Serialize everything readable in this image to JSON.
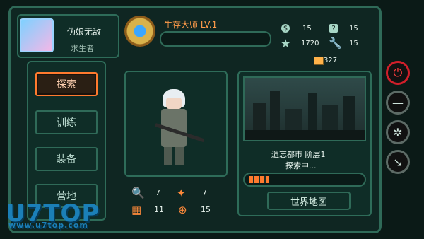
{
  "profile": {
    "name": "伪娘无敌",
    "role": "求生者"
  },
  "rank": {
    "title": "生存大师 LV.1"
  },
  "stats": {
    "coins": "15",
    "help": "15",
    "stars": "1720",
    "tools": "15",
    "capacity": "327"
  },
  "sidebar": {
    "items": [
      {
        "label": "探索",
        "active": true
      },
      {
        "label": "训练",
        "active": false
      },
      {
        "label": "装备",
        "active": false
      },
      {
        "label": "营地",
        "active": false
      }
    ]
  },
  "character": {
    "attributes": [
      {
        "icon": "magnifier-icon",
        "value": "7"
      },
      {
        "icon": "bullet-icon",
        "value": "7"
      },
      {
        "icon": "backpack-icon",
        "value": "11"
      },
      {
        "icon": "crosshair-icon",
        "value": "15"
      }
    ]
  },
  "location": {
    "name": "遗忘都市 阶层1",
    "status": "探索中...",
    "map_button": "世界地图",
    "progress_fraction": 0.18
  },
  "watermark": {
    "brand": "U7TOP",
    "sub": "www.u7top.com"
  },
  "colors": {
    "accent_orange": "#ff7a2e",
    "panel_border": "#2e6c59",
    "power_red": "#d11f2a"
  }
}
